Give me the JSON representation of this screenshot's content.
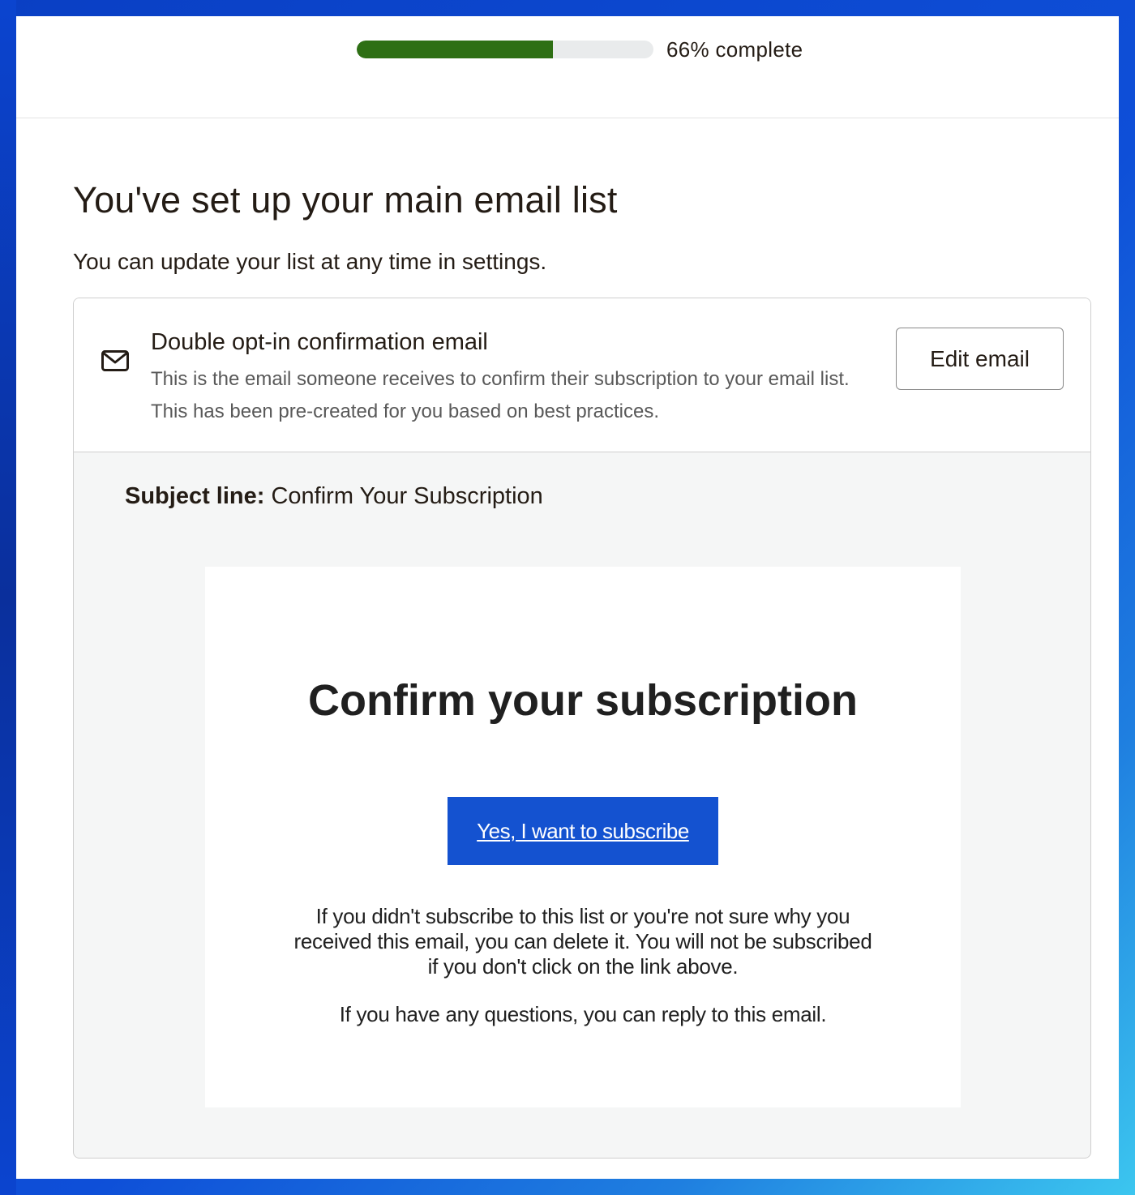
{
  "progress": {
    "value": 0.66,
    "label": "66% complete"
  },
  "page": {
    "title": "You've set up your main email list",
    "subtitle": "You can update your list at any time in settings."
  },
  "card": {
    "icon": "mail-icon",
    "title": "Double opt-in confirmation email",
    "description": "This is the email someone receives to confirm their subscription to your email list. This has been pre-created for you based on best practices.",
    "edit_button_label": "Edit email",
    "subject_label": "Subject line:",
    "subject_value": "Confirm Your Subscription"
  },
  "email_preview": {
    "heading": "Confirm your subscription",
    "button_label": "Yes, I want to subscribe",
    "body_paragraph_1": "If you didn't subscribe to this list or you're not sure why you received this email, you can delete it. You will not be subscribed if you don't click on the link above.",
    "body_paragraph_2": "If you have any questions, you can reply to this email."
  },
  "colors": {
    "progress_fill": "#2e6f14",
    "progress_track": "#e9ebec",
    "subscribe_button": "#1452d0",
    "text_primary": "#241c15",
    "text_secondary": "#595959"
  }
}
